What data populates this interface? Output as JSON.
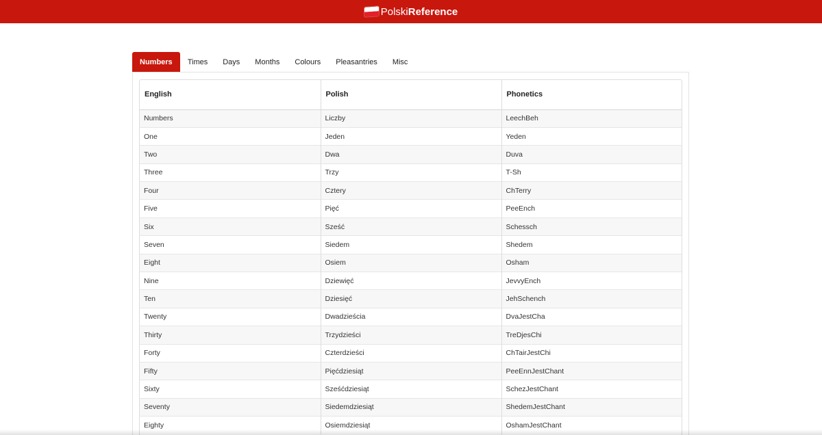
{
  "header": {
    "brand_light": "Polski",
    "brand_bold": "Reference",
    "flag_icon": "polish-flag-icon",
    "background_color": "#c8170d"
  },
  "tabs": [
    {
      "label": "Numbers",
      "active": true
    },
    {
      "label": "Times",
      "active": false
    },
    {
      "label": "Days",
      "active": false
    },
    {
      "label": "Months",
      "active": false
    },
    {
      "label": "Colours",
      "active": false
    },
    {
      "label": "Pleasantries",
      "active": false
    },
    {
      "label": "Misc",
      "active": false
    }
  ],
  "table": {
    "columns": [
      "English",
      "Polish",
      "Phonetics"
    ],
    "rows": [
      [
        "Numbers",
        "Liczby",
        "LeechBeh"
      ],
      [
        "One",
        "Jeden",
        "Yeden"
      ],
      [
        "Two",
        "Dwa",
        "Duva"
      ],
      [
        "Three",
        "Trzy",
        "T-Sh"
      ],
      [
        "Four",
        "Cztery",
        "ChTerry"
      ],
      [
        "Five",
        "Pięć",
        "PeeEnch"
      ],
      [
        "Six",
        "Sześć",
        "Schessch"
      ],
      [
        "Seven",
        "Siedem",
        "Shedem"
      ],
      [
        "Eight",
        "Osiem",
        "Osham"
      ],
      [
        "Nine",
        "Dziewięć",
        "JevvyEnch"
      ],
      [
        "Ten",
        "Dziesięć",
        "JehSchench"
      ],
      [
        "Twenty",
        "Dwadzieścia",
        "DvaJestCha"
      ],
      [
        "Thirty",
        "Trzydzieści",
        "TreDjesChi"
      ],
      [
        "Forty",
        "Czterdzieści",
        "ChTairJestChi"
      ],
      [
        "Fifty",
        "Pięćdziesiąt",
        "PeeEnnJestChant"
      ],
      [
        "Sixty",
        "Sześćdziesiąt",
        "SchezJestChant"
      ],
      [
        "Seventy",
        "Siedemdziesiąt",
        "ShedemJestChant"
      ],
      [
        "Eighty",
        "Osiemdziesiąt",
        "OshamJestChant"
      ]
    ]
  }
}
